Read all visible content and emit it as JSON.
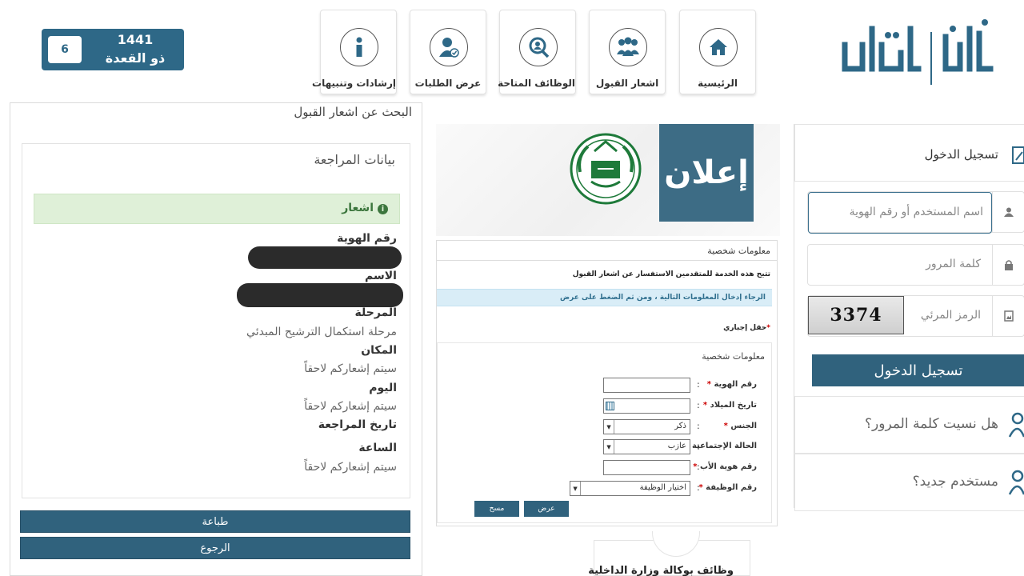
{
  "header": {
    "nav": [
      {
        "label": "الرئيسية",
        "icon": "home-icon"
      },
      {
        "label": "اشعار القبول",
        "icon": "group-icon"
      },
      {
        "label": "الوظائف المتاحة",
        "icon": "job-search-icon"
      },
      {
        "label": "عرض الطلبات",
        "icon": "user-check-icon"
      },
      {
        "label": "إرشادات وتنبيهات",
        "icon": "info-icon"
      }
    ],
    "date": {
      "day": "6",
      "year": "1441",
      "month": "ذو القعدة"
    },
    "logo_text": "أبشر | توظيف"
  },
  "left_panel": {
    "title": "البحث عن اشعار القبول",
    "section_title": "بيانات المراجعة",
    "alert": "اشعار",
    "fields": {
      "id_label": "رقم الهوية",
      "name_label": "الاسم",
      "stage_label": "المرحلة",
      "stage_value": "مرحلة استكمال الترشيح المبدئي",
      "place_label": "المكان",
      "place_value": "سيتم إشعاركم لاحقاً",
      "day_label": "اليوم",
      "day_value": "سيتم إشعاركم لاحقاً",
      "review_date_label": "تاريخ المراجعة",
      "time_label": "الساعة",
      "time_value": "سيتم إشعاركم لاحقاً"
    },
    "print_button": "طباعة",
    "back_button": "الرجوع"
  },
  "center": {
    "banner_text": "إعلان",
    "form": {
      "panel_title": "معلومات شخصية",
      "description": "تتيح هذه الخدمة للمتقدمين الاستفسار عن اشعار القبول",
      "info": "الرجاء إدخال المعلومات التالية ، ومن ثم الضغط على عرض",
      "required_note": "حقل إجباري",
      "section_title": "معلومات شخصية",
      "id_label": "رقم الهوية",
      "dob_label": "تاريخ الميلاد",
      "gender_label": "الجنس",
      "gender_value": "ذكر",
      "marital_label": "الحالة الإجتماعية",
      "marital_value": "عازب",
      "father_id_label": "رقم هوية الأب",
      "job_label": "رقم الوظيفة",
      "job_value": "اختيار الوظيفة",
      "show_button": "عرض",
      "clear_button": "مسح"
    },
    "bottom_text": "وظائف بوكالة وزارة الداخلية"
  },
  "right_panel": {
    "login_title": "تسجيل الدخول",
    "username_placeholder": "اسم المستخدم أو رقم الهوية",
    "password_placeholder": "كلمة المرور",
    "captcha_placeholder": "الرمز المرئي",
    "captcha_text": "3374",
    "login_button": "تسجيل الدخول",
    "forgot_password": "هل نسيت كلمة المرور؟",
    "new_user": "مستخدم جديد؟"
  },
  "colors": {
    "primary": "#30627d",
    "banner": "#3d6c85",
    "emblem_green": "#1e7a3a",
    "alert_bg": "#dff0d8",
    "info_bg": "#d9edf7",
    "required_star": "#cc0000"
  }
}
